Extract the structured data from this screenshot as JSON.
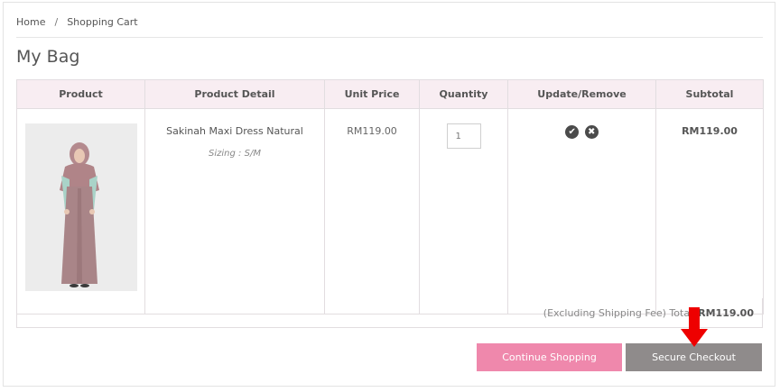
{
  "breadcrumb": {
    "home": "Home",
    "separator": "/",
    "current": "Shopping Cart"
  },
  "page_title": "My Bag",
  "table": {
    "headers": [
      "Product",
      "Product Detail",
      "Unit Price",
      "Quantity",
      "Update/Remove",
      "Subtotal"
    ],
    "rows": [
      {
        "product_name": "Sakinah Maxi Dress Natural",
        "sizing": "Sizing : S/M",
        "unit_price": "RM119.00",
        "quantity": "1",
        "subtotal": "RM119.00",
        "update_icon": "check-icon",
        "remove_icon": "close-icon"
      }
    ]
  },
  "total": {
    "label": "(Excluding Shipping Fee) Total",
    "amount": "RM119.00"
  },
  "buttons": {
    "continue": "Continue Shopping",
    "checkout": "Secure Checkout"
  },
  "colors": {
    "header_bg": "#f8edf2",
    "continue_btn": "#ef88ac",
    "checkout_btn": "#8f8b8b",
    "annotation_arrow": "#ee0000"
  }
}
